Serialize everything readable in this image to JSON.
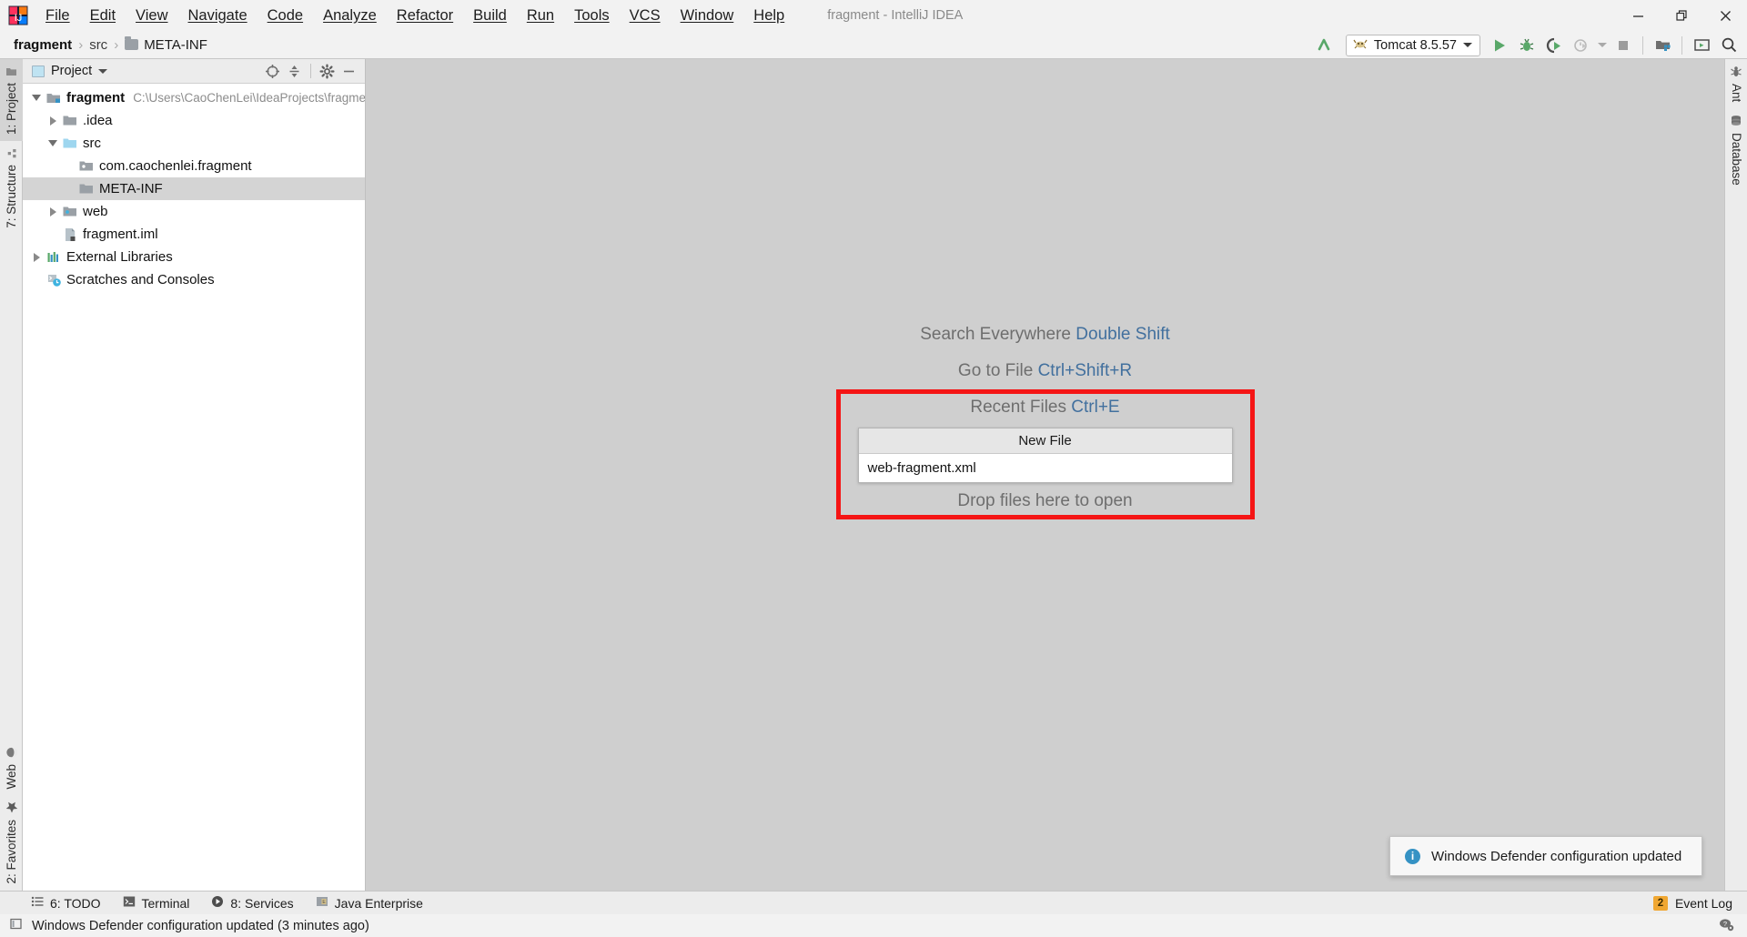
{
  "window": {
    "title": "fragment - IntelliJ IDEA",
    "logo_icon": "intellij-idea-logo",
    "minimize_icon": "minimize-icon",
    "maximize_icon": "restore-icon",
    "close_icon": "close-icon"
  },
  "menubar": {
    "items": [
      {
        "label": "File",
        "mnemonic": "F"
      },
      {
        "label": "Edit",
        "mnemonic": "E"
      },
      {
        "label": "View",
        "mnemonic": "V"
      },
      {
        "label": "Navigate",
        "mnemonic": "N"
      },
      {
        "label": "Code",
        "mnemonic": "C"
      },
      {
        "label": "Analyze",
        "mnemonic": "z"
      },
      {
        "label": "Refactor",
        "mnemonic": "R"
      },
      {
        "label": "Build",
        "mnemonic": "B"
      },
      {
        "label": "Run",
        "mnemonic": "u"
      },
      {
        "label": "Tools",
        "mnemonic": "T"
      },
      {
        "label": "VCS",
        "mnemonic": "S"
      },
      {
        "label": "Window",
        "mnemonic": "W"
      },
      {
        "label": "Help",
        "mnemonic": "H"
      }
    ]
  },
  "navbar": {
    "breadcrumbs": [
      {
        "label": "fragment",
        "style": "bold",
        "icon": null
      },
      {
        "label": "src",
        "style": "dim",
        "icon": null
      },
      {
        "label": "META-INF",
        "style": "normal",
        "icon": "folder-icon"
      }
    ],
    "separator": "›"
  },
  "toolbar": {
    "update_icon": "update-project-arrow-icon",
    "run_config": {
      "label": "Tomcat 8.5.57",
      "icon": "tomcat-icon",
      "dropdown_icon": "chevron-down-icon"
    },
    "buttons": [
      {
        "name": "run-button",
        "icon": "run-triangle-icon",
        "enabled": true
      },
      {
        "name": "debug-button",
        "icon": "debug-bug-icon",
        "enabled": true
      },
      {
        "name": "run-coverage-button",
        "icon": "run-with-coverage-icon",
        "enabled": true
      },
      {
        "name": "profiler-button",
        "icon": "profiler-clock-icon",
        "enabled": false
      },
      {
        "name": "stop-button",
        "icon": "stop-square-icon",
        "enabled": false
      },
      {
        "name": "project-structure-button",
        "icon": "project-structure-icon",
        "enabled": true
      },
      {
        "name": "terminal-button",
        "icon": "terminal-window-icon",
        "enabled": true
      },
      {
        "name": "search-button",
        "icon": "search-icon",
        "enabled": true
      }
    ]
  },
  "left_stripe": {
    "top": [
      {
        "label": "1: Project",
        "mnemonic": "1",
        "icon": "project-folder-icon",
        "active": true
      },
      {
        "label": "7: Structure",
        "mnemonic": "7",
        "icon": "structure-icon",
        "active": false
      }
    ],
    "bottom": [
      {
        "label": "Web",
        "mnemonic": "",
        "icon": "web-globe-icon",
        "active": false
      },
      {
        "label": "2: Favorites",
        "mnemonic": "2",
        "icon": "star-icon",
        "active": false
      }
    ]
  },
  "right_stripe": {
    "top": [
      {
        "label": "Ant",
        "icon": "ant-icon",
        "active": false
      },
      {
        "label": "Database",
        "icon": "database-icon",
        "active": false
      }
    ]
  },
  "project_tool_window": {
    "title": "Project",
    "title_icon": "project-view-icon",
    "dropdown_icon": "chevron-down-icon",
    "actions": [
      {
        "name": "select-opened-file-button",
        "icon": "locate-crosshair-icon"
      },
      {
        "name": "collapse-all-button",
        "icon": "collapse-all-icon"
      },
      {
        "name": "settings-button",
        "icon": "gear-icon"
      },
      {
        "name": "hide-button",
        "icon": "minimize-icon"
      }
    ],
    "tree": [
      {
        "label": "fragment",
        "secondary": "C:\\Users\\CaoChenLei\\IdeaProjects\\fragment",
        "indent": 0,
        "toggle": "expanded",
        "icon": "project-module-icon",
        "bold": true,
        "selected": false
      },
      {
        "label": ".idea",
        "secondary": "",
        "indent": 1,
        "toggle": "collapsed",
        "icon": "folder-gray-icon",
        "bold": false,
        "selected": false
      },
      {
        "label": "src",
        "secondary": "",
        "indent": 1,
        "toggle": "expanded",
        "icon": "folder-source-icon",
        "bold": false,
        "selected": false
      },
      {
        "label": "com.caochenlei.fragment",
        "secondary": "",
        "indent": 2,
        "toggle": "none",
        "icon": "package-icon",
        "bold": false,
        "selected": false
      },
      {
        "label": "META-INF",
        "secondary": "",
        "indent": 2,
        "toggle": "none",
        "icon": "folder-gray-icon",
        "bold": false,
        "selected": true
      },
      {
        "label": "web",
        "secondary": "",
        "indent": 1,
        "toggle": "collapsed",
        "icon": "folder-web-icon",
        "bold": false,
        "selected": false
      },
      {
        "label": "fragment.iml",
        "secondary": "",
        "indent": 1,
        "toggle": "none",
        "icon": "iml-file-icon",
        "bold": false,
        "selected": false
      },
      {
        "label": "External Libraries",
        "secondary": "",
        "indent": 0,
        "toggle": "collapsed",
        "icon": "libraries-icon",
        "bold": false,
        "selected": false
      },
      {
        "label": "Scratches and Consoles",
        "secondary": "",
        "indent": 0,
        "toggle": "none",
        "icon": "scratches-icon",
        "bold": false,
        "selected": false
      }
    ]
  },
  "editor": {
    "hints": [
      {
        "text": "Search Everywhere",
        "key": "Double Shift"
      },
      {
        "text": "Go to File",
        "key": "Ctrl+Shift+R"
      },
      {
        "text": "Recent Files",
        "key": "Ctrl+E"
      },
      {
        "text": "Drop files here to open",
        "key": ""
      }
    ],
    "popup": {
      "header": "New File",
      "items": [
        "web-fragment.xml"
      ]
    },
    "highlight_color": "#f51515"
  },
  "notification": {
    "icon": "info-icon",
    "icon_glyph": "i",
    "message": "Windows Defender configuration updated"
  },
  "bottom_bar": {
    "items": [
      {
        "label": "6: TODO",
        "mnemonic": "6",
        "icon": "todo-list-icon"
      },
      {
        "label": "Terminal",
        "mnemonic": "",
        "icon": "terminal-icon"
      },
      {
        "label": "8: Services",
        "mnemonic": "8",
        "icon": "services-play-icon"
      },
      {
        "label": "Java Enterprise",
        "mnemonic": "",
        "icon": "java-enterprise-icon"
      }
    ],
    "event_log": {
      "label": "Event Log",
      "count": "2"
    }
  },
  "status_bar": {
    "icon": "status-message-icon",
    "message": "Windows Defender configuration updated (3 minutes ago)",
    "right_icon": "help-settings-icon"
  }
}
